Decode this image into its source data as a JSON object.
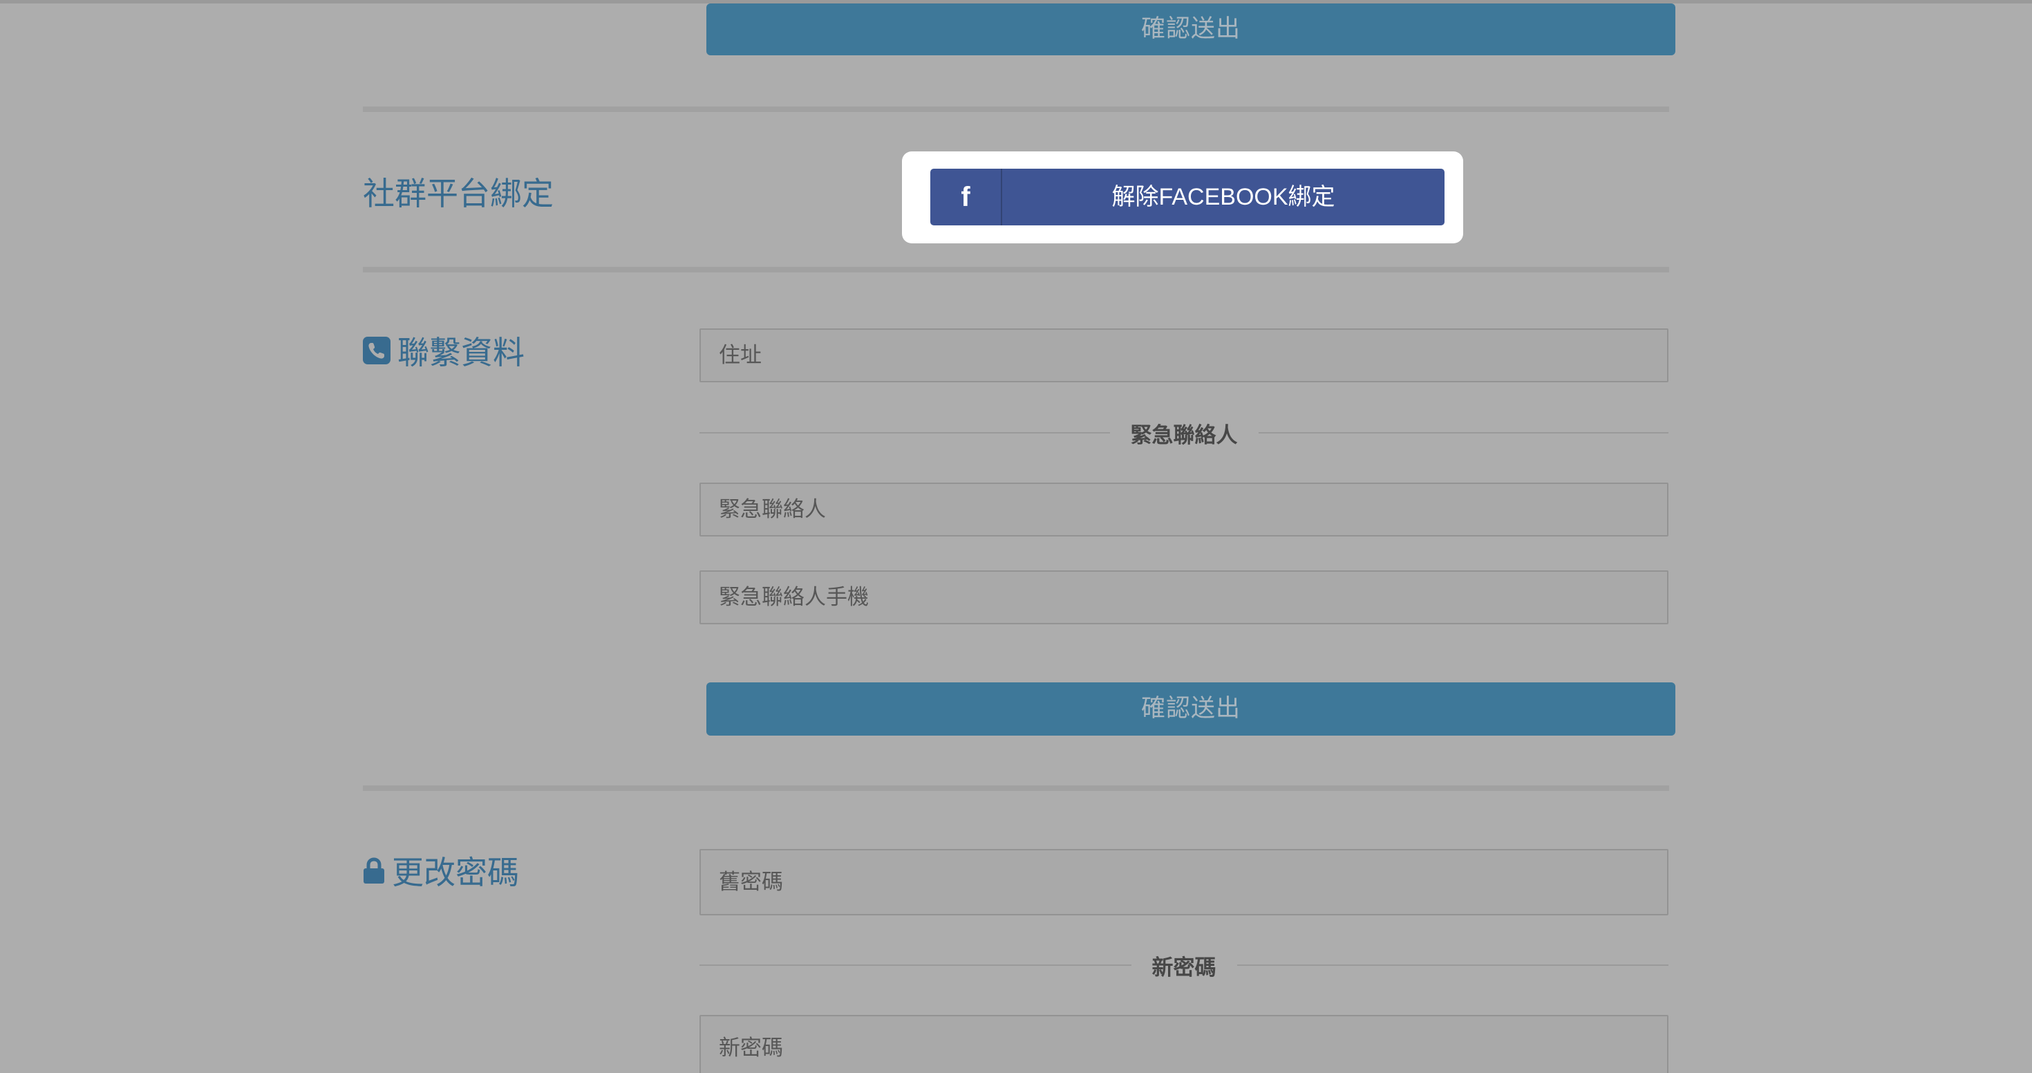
{
  "buttons": {
    "submit_label": "確認送出"
  },
  "social": {
    "title": "社群平台綁定",
    "facebook_icon": "f",
    "facebook_button": "解除FACEBOOK綁定"
  },
  "contact": {
    "title": "聯繫資料",
    "icon": "phone-icon",
    "address_placeholder": "住址",
    "emergency_heading": "緊急聯絡人",
    "emergency_name_placeholder": "緊急聯絡人",
    "emergency_phone_placeholder": "緊急聯絡人手機"
  },
  "password": {
    "title": "更改密碼",
    "icon": "lock-icon",
    "old_placeholder": "舊密碼",
    "new_heading": "新密碼",
    "new_placeholder": "新密碼"
  },
  "colors": {
    "background": "#adadad",
    "accent": "#3e7899",
    "facebook": "#3f5594",
    "title": "#386b8f"
  }
}
